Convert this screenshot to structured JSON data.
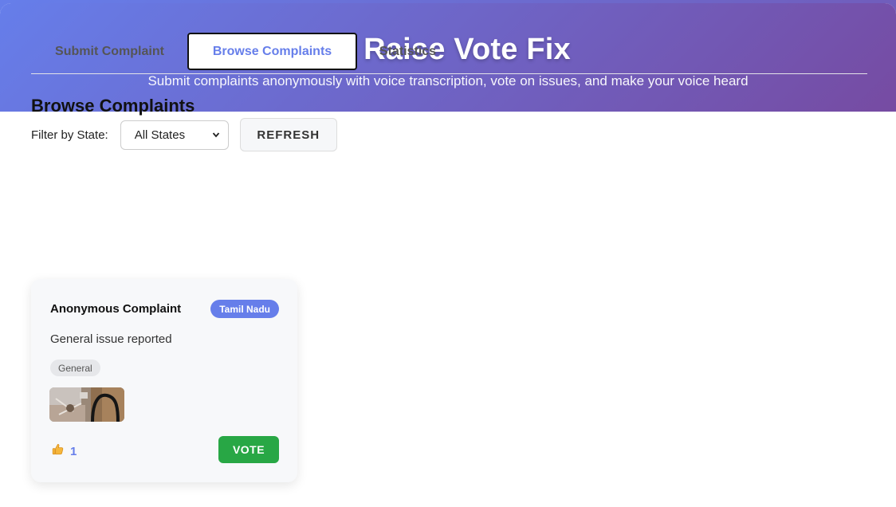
{
  "header": {
    "icon": "ballot-box-icon",
    "title": "Raise Vote Fix",
    "subtitle": "Submit complaints anonymously with voice transcription, vote on issues, and make your voice heard"
  },
  "tabs": [
    {
      "label": "Submit Complaint",
      "active": false
    },
    {
      "label": "Browse Complaints",
      "active": true
    },
    {
      "label": "Statistics",
      "active": false
    }
  ],
  "browse": {
    "title": "Browse Complaints",
    "filter_label": "Filter by State:",
    "filter_value": "All States",
    "refresh_label": "REFRESH"
  },
  "complaints": [
    {
      "title": "Anonymous Complaint",
      "state": "Tamil Nadu",
      "description": "General issue reported",
      "category": "General",
      "image": "complaint-photo",
      "vote_icon": "thumbs-up-icon",
      "votes": "1",
      "vote_label": "VOTE"
    }
  ],
  "colors": {
    "gradient_start": "#667eea",
    "gradient_end": "#764ba2",
    "accent": "#667eea",
    "vote_button": "#28a745"
  }
}
